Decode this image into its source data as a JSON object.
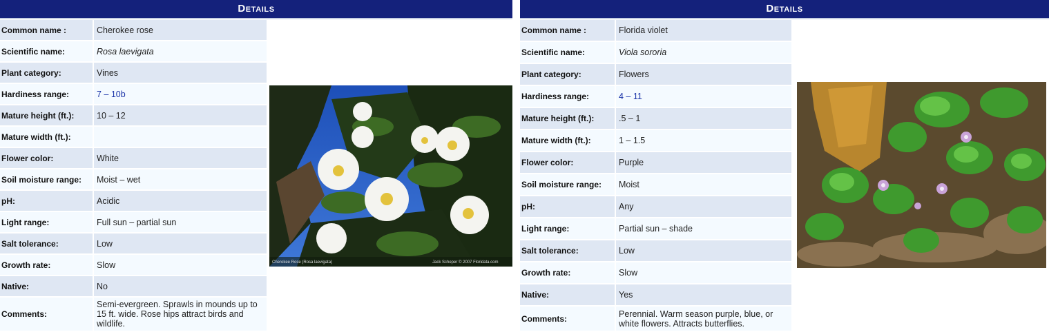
{
  "left": {
    "header": "Details",
    "rows": [
      {
        "label": "Common name :",
        "value": "Cherokee rose"
      },
      {
        "label": "Scientific name:",
        "value": "Rosa laevigata",
        "style": "italic"
      },
      {
        "label": "Plant category:",
        "value": "Vines"
      },
      {
        "label": "Hardiness range:",
        "value": "7 – 10b",
        "style": "link"
      },
      {
        "label": "Mature height (ft.):",
        "value": "10 – 12"
      },
      {
        "label": "Mature width (ft.):",
        "value": ""
      },
      {
        "label": "Flower color:",
        "value": "White"
      },
      {
        "label": "Soil moisture range:",
        "value": "Moist – wet"
      },
      {
        "label": "pH:",
        "value": "Acidic"
      },
      {
        "label": "Light range:",
        "value": "Full sun – partial sun"
      },
      {
        "label": "Salt tolerance:",
        "value": "Low"
      },
      {
        "label": "Growth rate:",
        "value": "Slow"
      },
      {
        "label": "Native:",
        "value": "No"
      },
      {
        "label": "Comments:",
        "value": "Semi-evergreen. Sprawls in mounds up to 15 ft. wide. Rose hips attract birds and wildlife."
      }
    ],
    "photo_caption_left": "Cherokee Rose  (Rosa laevigata)",
    "photo_caption_right": "Jack Scheper  © 2007 Floridata.com"
  },
  "right": {
    "header": "Details",
    "rows": [
      {
        "label": "Common name :",
        "value": "Florida violet"
      },
      {
        "label": "Scientific name:",
        "value": "Viola sororia",
        "style": "italic"
      },
      {
        "label": "Plant category:",
        "value": "Flowers"
      },
      {
        "label": "Hardiness range:",
        "value": "4 – 11",
        "style": "link"
      },
      {
        "label": "Mature height (ft.):",
        "value": ".5 – 1"
      },
      {
        "label": "Mature width (ft.):",
        "value": "1 – 1.5"
      },
      {
        "label": "Flower color:",
        "value": "Purple"
      },
      {
        "label": "Soil moisture range:",
        "value": "Moist"
      },
      {
        "label": "pH:",
        "value": "Any"
      },
      {
        "label": "Light range:",
        "value": "Partial sun – shade"
      },
      {
        "label": "Salt tolerance:",
        "value": "Low"
      },
      {
        "label": "Growth rate:",
        "value": "Slow"
      },
      {
        "label": "Native:",
        "value": "Yes"
      },
      {
        "label": "Comments:",
        "value": "Perennial. Warm season purple, blue, or white flowers. Attracts butterflies."
      }
    ]
  },
  "colors": {
    "header_bg": "#14217b",
    "row_odd": "#dfe7f3",
    "row_even": "#f4faff",
    "link": "#1a33a8"
  }
}
